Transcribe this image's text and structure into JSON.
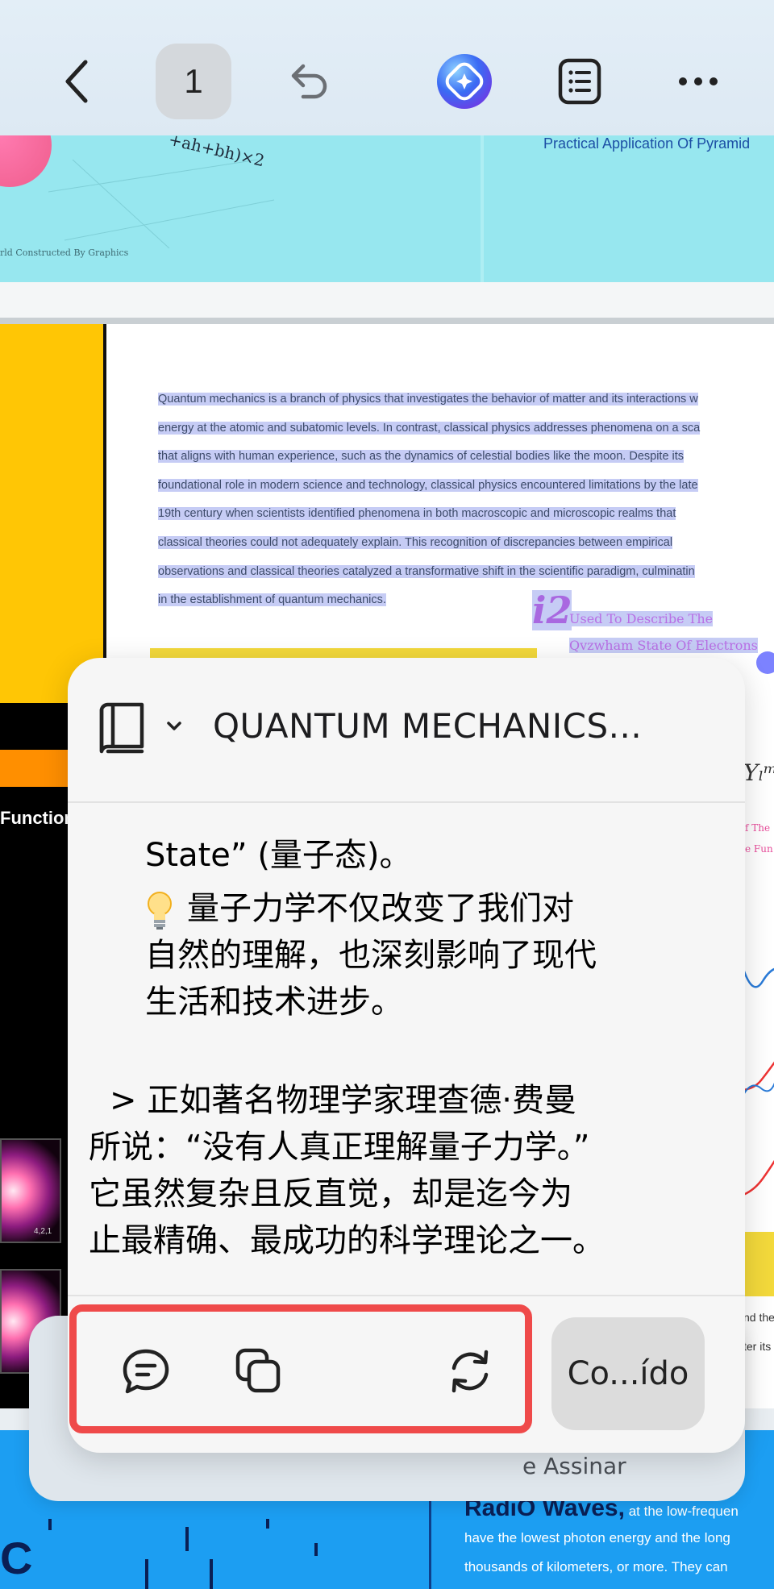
{
  "toolbar": {
    "page_number": "1"
  },
  "document": {
    "top_formula": "+ah+bh)×2",
    "top_caption": "rld Constructed By Graphics",
    "top_right_title": "Practical Application Of Pyramid",
    "paragraph_lines": [
      "Quantum mechanics is a branch of physics that investigates the behavior of matter and its interactions w",
      "energy at the atomic and subatomic levels. In contrast, classical physics addresses phenomena on a sca",
      "that aligns with human experience, such as the dynamics of celestial bodies like the moon. Despite its",
      "foundational role in modern science and technology, classical physics encountered limitations by the late",
      "19th century when scientists identified phenomena in both macroscopic and microscopic realms that",
      "classical theories could not adequately explain. This recognition of discrepancies between empirical",
      "observations and classical theories catalyzed a transformative shift in the scientific paradigm, culminatin",
      "in the establishment of quantum mechanics."
    ],
    "i2_label": "i2",
    "i2_desc_1": "Used To Describe The",
    "i2_desc_2": "Qvzwham State Of Electrons",
    "left_plus": "+",
    "left_function_label": "Function",
    "orb_label": "4,2,1",
    "right_math": "Yₗᵐ",
    "right_pink_1": "f The",
    "right_pink_2": "e Fun",
    "right_frag_1": "nd the",
    "right_frag_2": "ter its",
    "bottom_big_letter": "C",
    "radio_title": "RadiO Waves,",
    "radio_title_tail": " at the low-frequen",
    "radio_line_1": "have the lowest photon energy and the long",
    "radio_line_2": "thousands of kilometers, or more. They can"
  },
  "ai_panel": {
    "title": "QUANTUM MECHANICS...",
    "lines": {
      "l1": "State” (量子态)。",
      "l2": "量子力学不仅改变了我们对",
      "l3": "自然的理解，也深刻影响了现代",
      "l4": "生活和技术进步。",
      "l5": "> 正如著名物理学家理查德·费曼",
      "l6": "所说：“没有人真正理解量子力学。”",
      "l7": "它虽然复杂且反直觉，却是迄今为",
      "l8": "止最精确、最成功的科学理论之一。"
    },
    "confirm_label": "Co...ído",
    "behind_label": "e Assinar"
  },
  "icons": [
    "back-icon",
    "undo-icon",
    "ai-assistant-icon",
    "outline-icon",
    "more-icon",
    "book-icon",
    "chevron-down-icon",
    "lightbulb-icon",
    "comment-icon",
    "copy-icon",
    "refresh-icon"
  ],
  "colors": {
    "highlight": "#c6ccf5",
    "action_box_border": "#ef4a4a",
    "doc_cyan": "#97e7ef",
    "doc_blue": "#1c9ef2"
  }
}
